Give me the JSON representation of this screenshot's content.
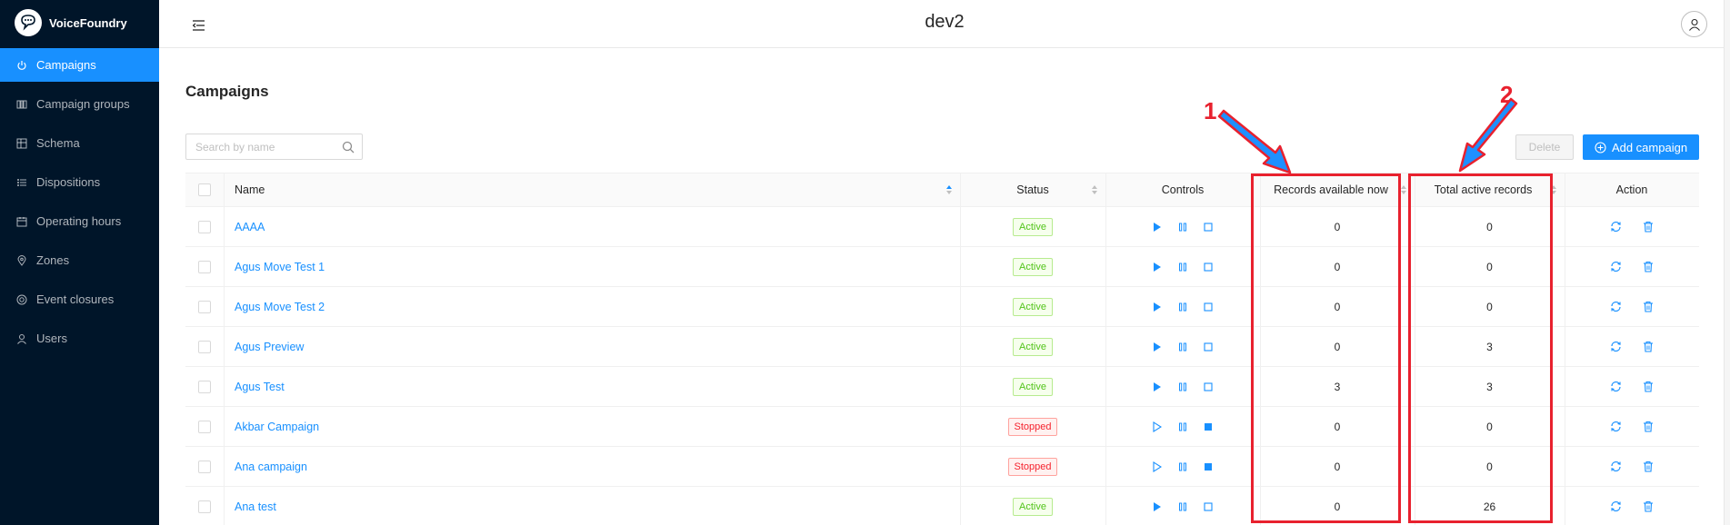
{
  "brand": {
    "name": "VoiceFoundry"
  },
  "sidebar": {
    "items": [
      {
        "label": "Campaigns",
        "icon": "power-icon",
        "active": true
      },
      {
        "label": "Campaign groups",
        "icon": "group-icon"
      },
      {
        "label": "Schema",
        "icon": "schema-icon"
      },
      {
        "label": "Dispositions",
        "icon": "list-icon"
      },
      {
        "label": "Operating hours",
        "icon": "calendar-icon"
      },
      {
        "label": "Zones",
        "icon": "pin-icon"
      },
      {
        "label": "Event closures",
        "icon": "target-icon"
      },
      {
        "label": "Users",
        "icon": "user-icon"
      }
    ]
  },
  "header": {
    "title": "dev2"
  },
  "page": {
    "title": "Campaigns",
    "search_placeholder": "Search by name",
    "delete_label": "Delete",
    "add_label": "Add campaign"
  },
  "table": {
    "columns": {
      "name": "Name",
      "status": "Status",
      "controls": "Controls",
      "available": "Records available now",
      "total": "Total active records",
      "action": "Action"
    },
    "rows": [
      {
        "name": "AAAA",
        "status": "Active",
        "available": "0",
        "total": "0"
      },
      {
        "name": "Agus Move Test 1",
        "status": "Active",
        "available": "0",
        "total": "0"
      },
      {
        "name": "Agus Move Test 2",
        "status": "Active",
        "available": "0",
        "total": "0"
      },
      {
        "name": "Agus Preview",
        "status": "Active",
        "available": "0",
        "total": "3"
      },
      {
        "name": "Agus Test",
        "status": "Active",
        "available": "3",
        "total": "3"
      },
      {
        "name": "Akbar Campaign",
        "status": "Stopped",
        "available": "0",
        "total": "0"
      },
      {
        "name": "Ana campaign",
        "status": "Stopped",
        "available": "0",
        "total": "0"
      },
      {
        "name": "Ana test",
        "status": "Active",
        "available": "0",
        "total": "26"
      }
    ]
  },
  "annotations": {
    "label_1": "1",
    "label_2": "2",
    "color": "#e8212e"
  },
  "colors": {
    "sidebar_bg": "#001529",
    "accent": "#1890ff",
    "active_tag": "#52c41a",
    "stopped_tag": "#f5222d"
  }
}
